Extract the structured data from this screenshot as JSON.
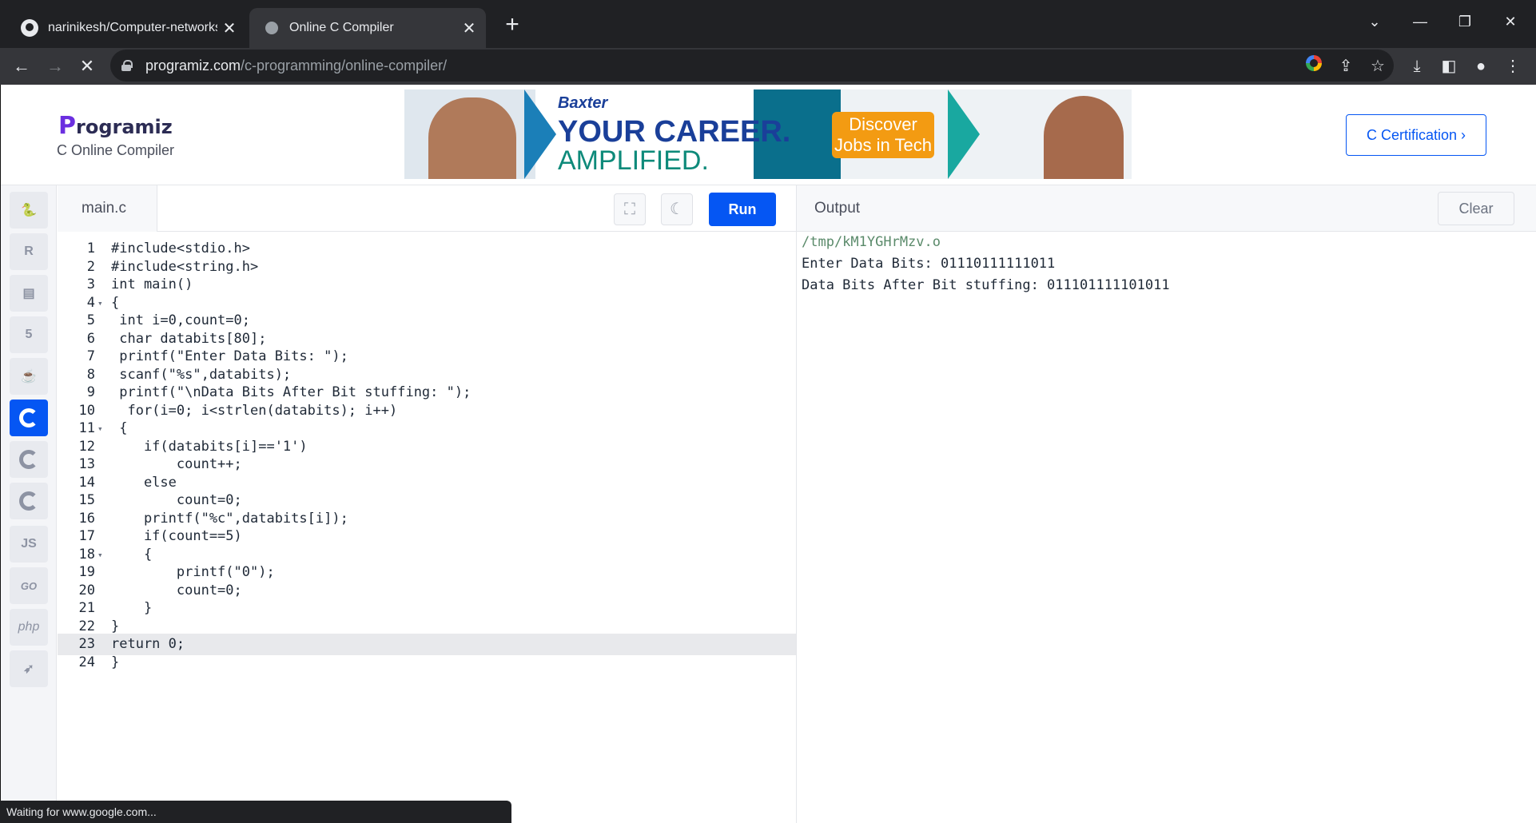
{
  "browser": {
    "tabs": [
      {
        "title": "narinikesh/Computer-networks-",
        "active": false
      },
      {
        "title": "Online C Compiler",
        "active": true
      }
    ],
    "url_host": "programiz.com",
    "url_path": "/c-programming/online-compiler/",
    "status_text": "Waiting for www.google.com..."
  },
  "header": {
    "logo_initial": "P",
    "logo_rest": "rogramiz",
    "subtitle": "C Online Compiler",
    "certification_button": "C Certification ›",
    "ad": {
      "brand": "Baxter",
      "headline_1": "YOUR CAREER.",
      "headline_2": "AMPLIFIED.",
      "cta": "Discover Jobs in Tech"
    }
  },
  "sidebar": {
    "languages": [
      "python",
      "r",
      "sql",
      "html",
      "java",
      "c",
      "cpp",
      "csharp",
      "JS",
      "GO",
      "php",
      "swift"
    ],
    "active": "c"
  },
  "editor": {
    "file_name": "main.c",
    "run_label": "Run",
    "lines": [
      "#include<stdio.h>",
      "#include<string.h>",
      "int main()",
      "{",
      " int i=0,count=0;",
      " char databits[80];",
      " printf(\"Enter Data Bits: \");",
      " scanf(\"%s\",databits);",
      " printf(\"\\nData Bits After Bit stuffing: \");",
      "  for(i=0; i<strlen(databits); i++)",
      " {",
      "    if(databits[i]=='1')",
      "        count++;",
      "    else",
      "        count=0;",
      "    printf(\"%c\",databits[i]);",
      "    if(count==5)",
      "    {",
      "        printf(\"0\");",
      "        count=0;",
      "    }",
      "}",
      "return 0;",
      "}"
    ],
    "highlighted_line": 23,
    "fold_lines": [
      4,
      11,
      18
    ]
  },
  "output": {
    "title": "Output",
    "clear_label": "Clear",
    "lines": [
      "/tmp/kM1YGHrMzv.o",
      "Enter Data Bits: 01110111111011",
      "Data Bits After Bit stuffing: 011101111101011"
    ]
  },
  "colors": {
    "accent": "#0556f3",
    "browser_bg": "#202124",
    "toolbar_bg": "#35363a"
  }
}
